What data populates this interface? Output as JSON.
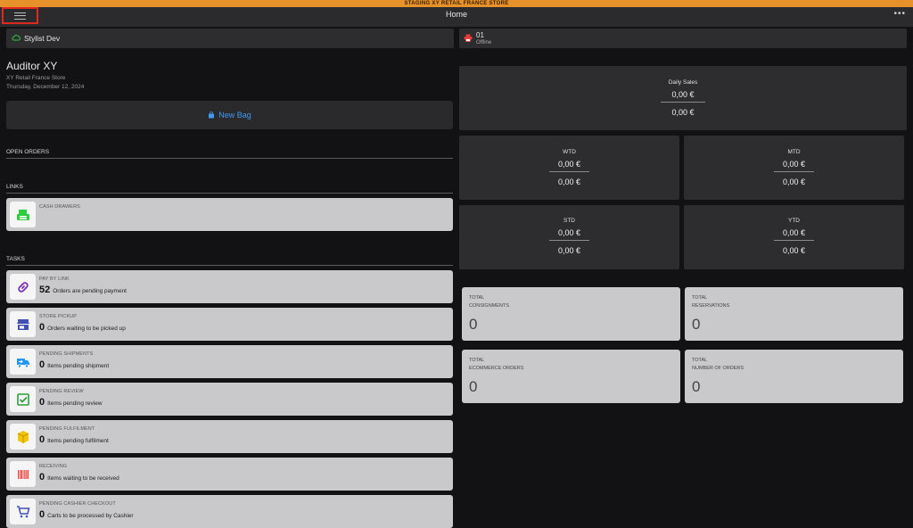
{
  "env_banner": "STAGING XY RETAIL FRANCE STORE",
  "header": {
    "title": "Home",
    "more_icon": "more-horizontal-icon"
  },
  "stylist": {
    "name": "Stylist Dev"
  },
  "printer": {
    "number": "01",
    "status": "Offline"
  },
  "user": {
    "name": "Auditor XY",
    "store": "XY Retail France Store",
    "date": "Thursday, December 12, 2024"
  },
  "new_bag": {
    "label": "New Bag"
  },
  "sections": {
    "open_orders": "OPEN ORDERS",
    "links": "LINKS",
    "tasks": "TASKS"
  },
  "links": [
    {
      "title": "CASH DRAWERS",
      "icon": "cash-register-icon"
    }
  ],
  "tasks": [
    {
      "title": "PAY BY LINK",
      "count": "52",
      "desc": "Orders are pending payment",
      "icon": "link-icon",
      "color": "#7b2fb3"
    },
    {
      "title": "STORE PICKUP",
      "count": "0",
      "desc": "Orders waiting to be picked up",
      "icon": "store-icon",
      "color": "#3f51b5"
    },
    {
      "title": "PENDING SHIPMENTS",
      "count": "0",
      "desc": "Items pending shipment",
      "icon": "truck-icon",
      "color": "#2196f3"
    },
    {
      "title": "PENDING REVIEW",
      "count": "0",
      "desc": "Items pending review",
      "icon": "checkbox-icon",
      "color": "#2e9e3e"
    },
    {
      "title": "PENDING FULFILMENT",
      "count": "0",
      "desc": "Items pending fulfilment",
      "icon": "package-icon",
      "color": "#f5c400"
    },
    {
      "title": "RECEIVING",
      "count": "0",
      "desc": "Items waiting to be received",
      "icon": "barcode-icon",
      "color": "#e53935"
    },
    {
      "title": "PENDING CASHIER CHECKOUT",
      "count": "0",
      "desc": "Carts to be processed by Cashier",
      "icon": "cart-icon",
      "color": "#3f51b5"
    }
  ],
  "sales": {
    "daily": {
      "label": "Daily Sales",
      "v1": "0,00 €",
      "v2": "0,00 €"
    },
    "wtd": {
      "label": "WTD",
      "v1": "0,00 €",
      "v2": "0,00 €"
    },
    "mtd": {
      "label": "MTD",
      "v1": "0,00 €",
      "v2": "0,00 €"
    },
    "std": {
      "label": "STD",
      "v1": "0,00 €",
      "v2": "0,00 €"
    },
    "ytd": {
      "label": "YTD",
      "v1": "0,00 €",
      "v2": "0,00 €"
    }
  },
  "totals": [
    {
      "l1": "TOTAL",
      "l2": "CONSIGNMENTS",
      "value": "0"
    },
    {
      "l1": "TOTAL",
      "l2": "RESERVATIONS",
      "value": "0"
    },
    {
      "l1": "TOTAL",
      "l2": "ECOMMERCE ORDERS",
      "value": "0"
    },
    {
      "l1": "TOTAL",
      "l2": "NUMBER OF ORDERS",
      "value": "0"
    }
  ],
  "colors": {
    "accent": "#3f9af2",
    "env_banner": "#e7912b",
    "highlight": "#e0281e",
    "cash_green": "#2ecc40"
  }
}
